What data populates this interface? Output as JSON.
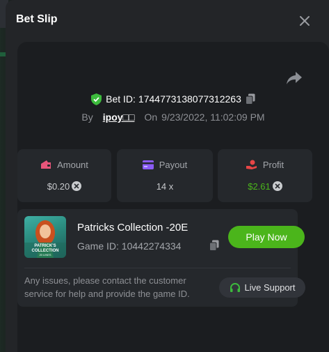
{
  "modal": {
    "title": "Bet Slip"
  },
  "bet": {
    "id_label": "Bet ID:",
    "id_value": "1744773138077312263",
    "by_label": "By",
    "username": "ipoy□□",
    "on_label": "On",
    "date": "9/23/2022, 11:02:09 PM"
  },
  "stats": [
    {
      "label": "Amount",
      "value": "$0.20",
      "icon": "wallet-icon",
      "color": "#e8557a"
    },
    {
      "label": "Payout",
      "value": "14 x",
      "icon": "card-icon",
      "color": "#8b5cf6"
    },
    {
      "label": "Profit",
      "value": "$2.61",
      "icon": "hand-coin-icon",
      "color": "#e84646"
    }
  ],
  "colors": {
    "profit_positive": "#4bb51b",
    "accent_green": "#4bb51b",
    "shield_green": "#3dbb3d"
  },
  "game": {
    "thumb_title": "PATRICK'S COLLECTION",
    "thumb_sub": "20 LINES",
    "name": "Patricks Collection -20E",
    "id_text": "Game ID: 10442274334",
    "play_label": "Play Now"
  },
  "support": {
    "text": "Any issues, please contact the customer service for help and provide the game ID.",
    "button_label": "Live Support"
  }
}
